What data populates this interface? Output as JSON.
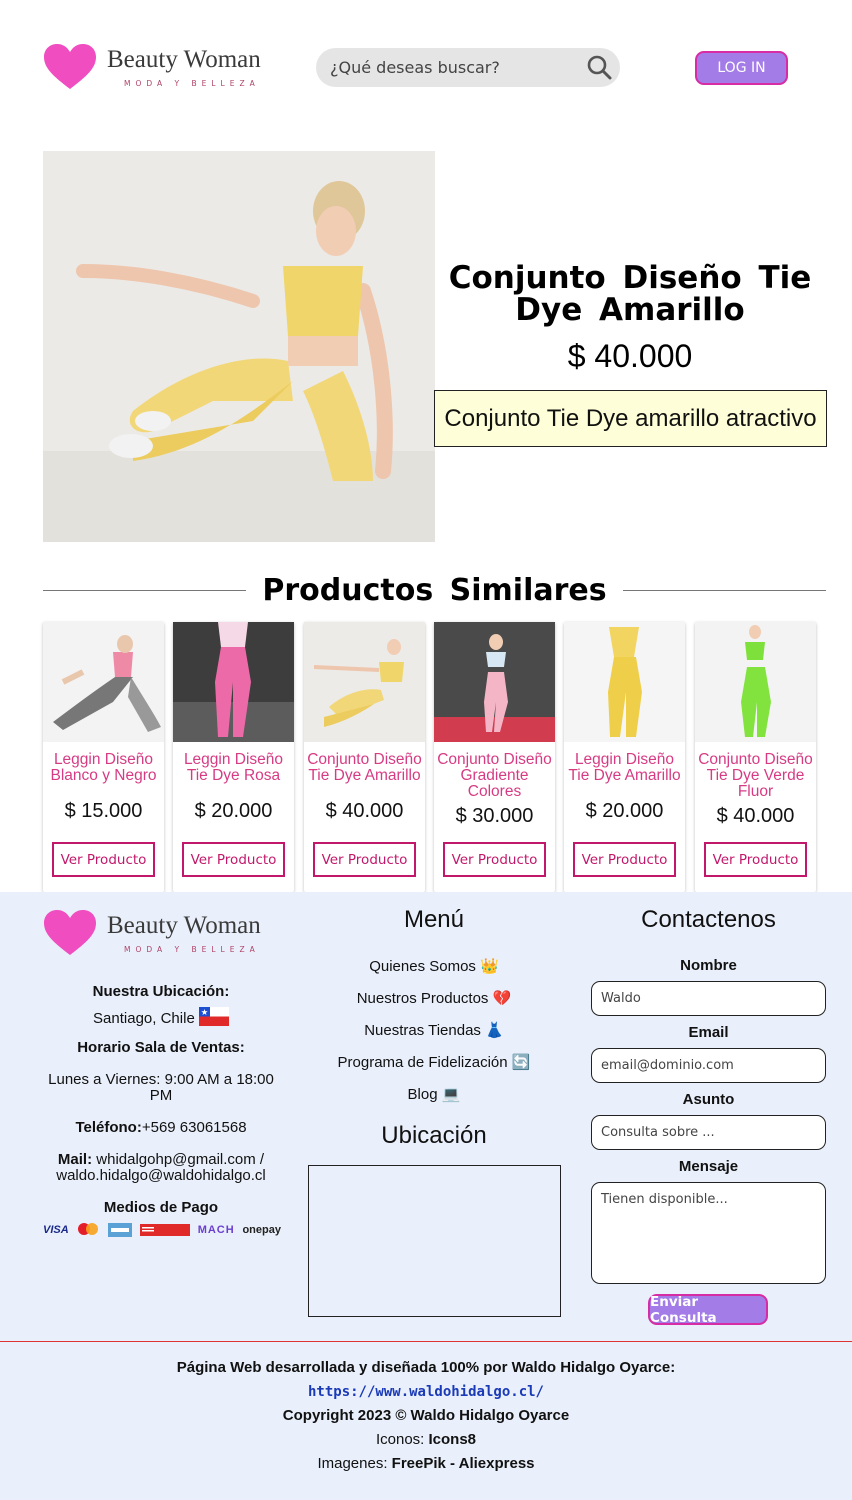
{
  "header": {
    "brand": "Beauty Woman",
    "tagline": "MODA Y BELLEZA",
    "search_placeholder": "¿Qué deseas buscar?",
    "login_label": "LOG IN"
  },
  "product": {
    "title": "Conjunto Diseño Tie Dye Amarillo",
    "price": "$ 40.000",
    "description": "Conjunto Tie Dye amarillo atractivo"
  },
  "similar": {
    "heading": "Productos Similares",
    "items": [
      {
        "name": "Leggin Diseño Blanco y Negro",
        "price": "$ 15.000",
        "button": "Ver Producto"
      },
      {
        "name": "Leggin Diseño Tie Dye Rosa",
        "price": "$ 20.000",
        "button": "Ver Producto"
      },
      {
        "name": "Conjunto Diseño Tie Dye Amarillo",
        "price": "$ 40.000",
        "button": "Ver Producto"
      },
      {
        "name": "Conjunto Diseño Gradiente Colores",
        "price": "$ 30.000",
        "button": "Ver Producto"
      },
      {
        "name": "Leggin Diseño Tie Dye Amarillo",
        "price": "$ 20.000",
        "button": "Ver Producto"
      },
      {
        "name": "Conjunto Diseño Tie Dye Verde Fluor",
        "price": "$ 40.000",
        "button": "Ver Producto"
      }
    ]
  },
  "footer": {
    "brand": "Beauty Woman",
    "tagline": "MODA Y BELLEZA",
    "location_label": "Nuestra Ubicación:",
    "location_value": "Santiago, Chile",
    "hours_label": "Horario Sala de Ventas:",
    "hours_value": "Lunes a Viernes: 9:00 AM a 18:00 PM",
    "phone_label": "Teléfono:",
    "phone_value": "+569 63061568",
    "mail_label": "Mail:",
    "mail_value": "whidalgohp@gmail.com / waldo.hidalgo@waldohidalgo.cl",
    "payment_label": "Medios de Pago",
    "payment_methods": [
      "VISA",
      "mastercard",
      "Banco Estado",
      "Redcompra",
      "MACH",
      "onepay"
    ],
    "menu_title": "Menú",
    "menu_items": [
      {
        "label": "Quienes Somos",
        "emoji": "👑"
      },
      {
        "label": "Nuestros Productos",
        "emoji": "💔"
      },
      {
        "label": "Nuestras Tiendas",
        "emoji": "👗"
      },
      {
        "label": "Programa de Fidelización",
        "emoji": "🔄"
      },
      {
        "label": "Blog",
        "emoji": "💻"
      }
    ],
    "location_title": "Ubicación",
    "contact_title": "Contactenos",
    "contact": {
      "name_label": "Nombre",
      "name_placeholder": "Waldo",
      "email_label": "Email",
      "email_placeholder": "email@dominio.com",
      "subject_label": "Asunto",
      "subject_placeholder": "Consulta sobre ...",
      "message_label": "Mensaje",
      "message_placeholder": "Tienen disponible...",
      "send_label": "Enviar Consulta"
    }
  },
  "credits": {
    "line1": "Página Web desarrollada y diseñada 100% por Waldo Hidalgo Oyarce:",
    "link": "https://www.waldohidalgo.cl/",
    "copyright": "Copyright 2023 © Waldo Hidalgo Oyarce",
    "icons_label": "Iconos: ",
    "icons_value": "Icons8",
    "images_label": "Imagenes: ",
    "images_value": "FreePik - Aliexpress"
  },
  "colors": {
    "accent_purple": "#a47ce8",
    "accent_pink": "#d62ca4",
    "product_link": "#d63b84",
    "footer_bg": "#eaf0fb",
    "heart": "#f04dc0"
  }
}
